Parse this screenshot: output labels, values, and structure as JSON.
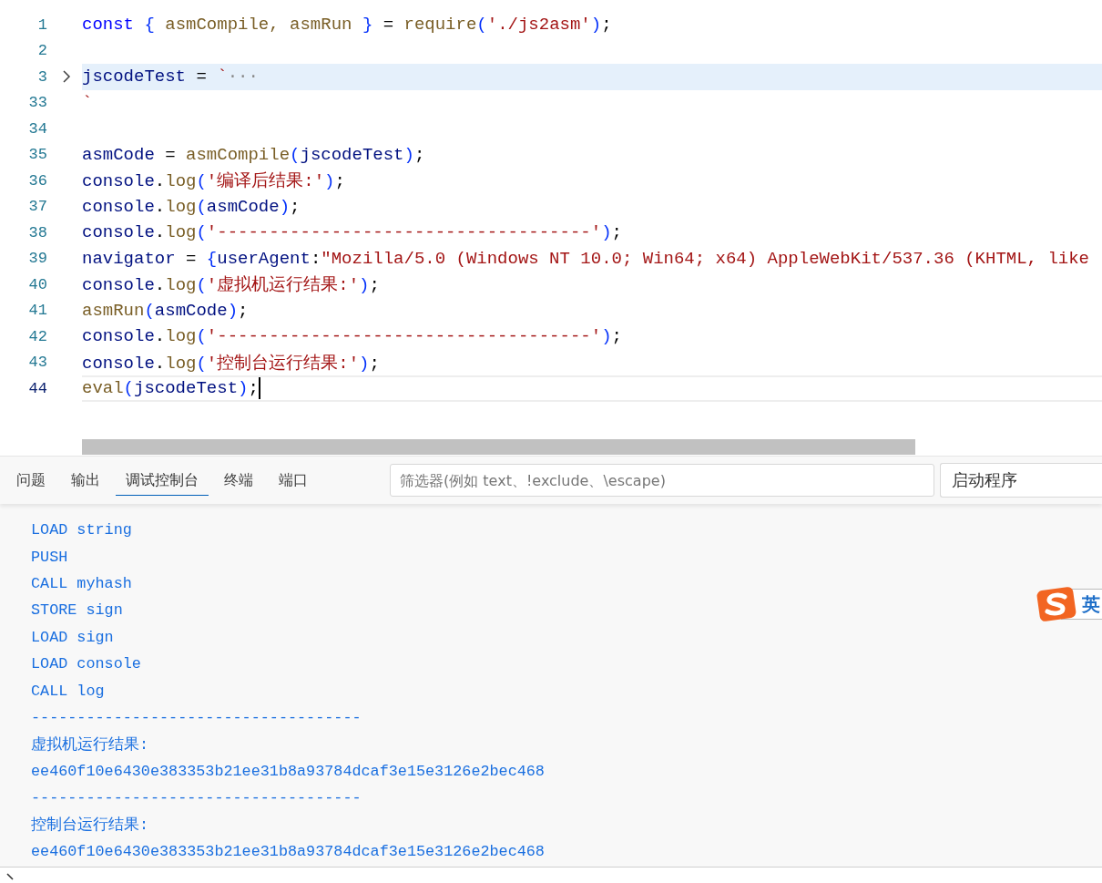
{
  "editor": {
    "lines": [
      {
        "number": "1",
        "folded": false,
        "highlighted": false,
        "current": false,
        "tokens": [
          {
            "text": "const ",
            "kind": "kw"
          },
          {
            "text": "{",
            "kind": "br"
          },
          {
            "text": " asmCompile, asmRun ",
            "kind": "fn"
          },
          {
            "text": "}",
            "kind": "br"
          },
          {
            "text": " = ",
            "kind": "p"
          },
          {
            "text": "require",
            "kind": "fn"
          },
          {
            "text": "(",
            "kind": "br"
          },
          {
            "text": "'./js2asm'",
            "kind": "str"
          },
          {
            "text": ")",
            "kind": "br"
          },
          {
            "text": ";",
            "kind": "p"
          }
        ]
      },
      {
        "number": "2",
        "folded": false,
        "highlighted": false,
        "current": false
      },
      {
        "number": "3",
        "folded": true,
        "highlighted": true,
        "current": false,
        "tokens": [
          {
            "text": "jscodeTest",
            "kind": "var"
          },
          {
            "text": " = ",
            "kind": "p"
          },
          {
            "text": "`",
            "kind": "str"
          },
          {
            "text": "···",
            "kind": "fold"
          }
        ]
      },
      {
        "number": "33",
        "folded": false,
        "highlighted": false,
        "current": false,
        "tokens": [
          {
            "text": "`",
            "kind": "str"
          }
        ]
      },
      {
        "number": "34",
        "folded": false,
        "highlighted": false,
        "current": false
      },
      {
        "number": "35",
        "folded": false,
        "highlighted": false,
        "current": false,
        "tokens": [
          {
            "text": "asmCode",
            "kind": "var"
          },
          {
            "text": " = ",
            "kind": "p"
          },
          {
            "text": "asmCompile",
            "kind": "fn"
          },
          {
            "text": "(",
            "kind": "br"
          },
          {
            "text": "jscodeTest",
            "kind": "var"
          },
          {
            "text": ")",
            "kind": "br"
          },
          {
            "text": ";",
            "kind": "p"
          }
        ]
      },
      {
        "number": "36",
        "folded": false,
        "highlighted": false,
        "current": false,
        "tokens": [
          {
            "text": "console",
            "kind": "var"
          },
          {
            "text": ".",
            "kind": "p"
          },
          {
            "text": "log",
            "kind": "fn"
          },
          {
            "text": "(",
            "kind": "br"
          },
          {
            "text": "'编译后结果:'",
            "kind": "str"
          },
          {
            "text": ")",
            "kind": "br"
          },
          {
            "text": ";",
            "kind": "p"
          }
        ]
      },
      {
        "number": "37",
        "folded": false,
        "highlighted": false,
        "current": false,
        "tokens": [
          {
            "text": "console",
            "kind": "var"
          },
          {
            "text": ".",
            "kind": "p"
          },
          {
            "text": "log",
            "kind": "fn"
          },
          {
            "text": "(",
            "kind": "br"
          },
          {
            "text": "asmCode",
            "kind": "var"
          },
          {
            "text": ")",
            "kind": "br"
          },
          {
            "text": ";",
            "kind": "p"
          }
        ]
      },
      {
        "number": "38",
        "folded": false,
        "highlighted": false,
        "current": false,
        "tokens": [
          {
            "text": "console",
            "kind": "var"
          },
          {
            "text": ".",
            "kind": "p"
          },
          {
            "text": "log",
            "kind": "fn"
          },
          {
            "text": "(",
            "kind": "br"
          },
          {
            "text": "'------------------------------------'",
            "kind": "str"
          },
          {
            "text": ")",
            "kind": "br"
          },
          {
            "text": ";",
            "kind": "p"
          }
        ]
      },
      {
        "number": "39",
        "folded": false,
        "highlighted": false,
        "current": false,
        "tokens": [
          {
            "text": "navigator",
            "kind": "var"
          },
          {
            "text": " = ",
            "kind": "p"
          },
          {
            "text": "{",
            "kind": "br"
          },
          {
            "text": "userAgent",
            "kind": "var"
          },
          {
            "text": ":",
            "kind": "p"
          },
          {
            "text": "\"Mozilla/5.0 (Windows NT 10.0; Win64; x64) AppleWebKit/537.36 (KHTML, like",
            "kind": "str"
          }
        ]
      },
      {
        "number": "40",
        "folded": false,
        "highlighted": false,
        "current": false,
        "tokens": [
          {
            "text": "console",
            "kind": "var"
          },
          {
            "text": ".",
            "kind": "p"
          },
          {
            "text": "log",
            "kind": "fn"
          },
          {
            "text": "(",
            "kind": "br"
          },
          {
            "text": "'虚拟机运行结果:'",
            "kind": "str"
          },
          {
            "text": ")",
            "kind": "br"
          },
          {
            "text": ";",
            "kind": "p"
          }
        ]
      },
      {
        "number": "41",
        "folded": false,
        "highlighted": false,
        "current": false,
        "tokens": [
          {
            "text": "asmRun",
            "kind": "fn"
          },
          {
            "text": "(",
            "kind": "br"
          },
          {
            "text": "asmCode",
            "kind": "var"
          },
          {
            "text": ")",
            "kind": "br"
          },
          {
            "text": ";",
            "kind": "p"
          }
        ]
      },
      {
        "number": "42",
        "folded": false,
        "highlighted": false,
        "current": false,
        "tokens": [
          {
            "text": "console",
            "kind": "var"
          },
          {
            "text": ".",
            "kind": "p"
          },
          {
            "text": "log",
            "kind": "fn"
          },
          {
            "text": "(",
            "kind": "br"
          },
          {
            "text": "'------------------------------------'",
            "kind": "str"
          },
          {
            "text": ")",
            "kind": "br"
          },
          {
            "text": ";",
            "kind": "p"
          }
        ]
      },
      {
        "number": "43",
        "folded": false,
        "highlighted": false,
        "current": false,
        "tokens": [
          {
            "text": "console",
            "kind": "var"
          },
          {
            "text": ".",
            "kind": "p"
          },
          {
            "text": "log",
            "kind": "fn"
          },
          {
            "text": "(",
            "kind": "br"
          },
          {
            "text": "'控制台运行结果:'",
            "kind": "str"
          },
          {
            "text": ")",
            "kind": "br"
          },
          {
            "text": ";",
            "kind": "p"
          }
        ]
      },
      {
        "number": "44",
        "folded": false,
        "highlighted": false,
        "current": true,
        "tokens": [
          {
            "text": "eval",
            "kind": "fn"
          },
          {
            "text": "(",
            "kind": "br"
          },
          {
            "text": "jscodeTest",
            "kind": "var"
          },
          {
            "text": ")",
            "kind": "br"
          },
          {
            "text": ";",
            "kind": "p"
          }
        ]
      }
    ]
  },
  "panel": {
    "tabs": [
      {
        "label": "问题",
        "selected": false
      },
      {
        "label": "输出",
        "selected": false
      },
      {
        "label": "调试控制台",
        "selected": true
      },
      {
        "label": "终端",
        "selected": false
      },
      {
        "label": "端口",
        "selected": false
      }
    ],
    "filter": {
      "placeholder": "筛选器(例如 text、!exclude、\\escape)"
    },
    "launch_select": {
      "value": "启动程序"
    },
    "console_lines": [
      "LOAD string",
      "PUSH",
      "CALL myhash",
      "STORE sign",
      "LOAD sign",
      "LOAD console",
      "CALL log",
      "------------------------------------",
      "虚拟机运行结果:",
      "ee460f10e6430e383353b21ee31b8a93784dcaf3e15e3126e2bec468",
      "------------------------------------",
      "控制台运行结果:",
      "ee460f10e6430e383353b21ee31b8a93784dcaf3e15e3126e2bec468"
    ],
    "ime_indicator": "英"
  }
}
